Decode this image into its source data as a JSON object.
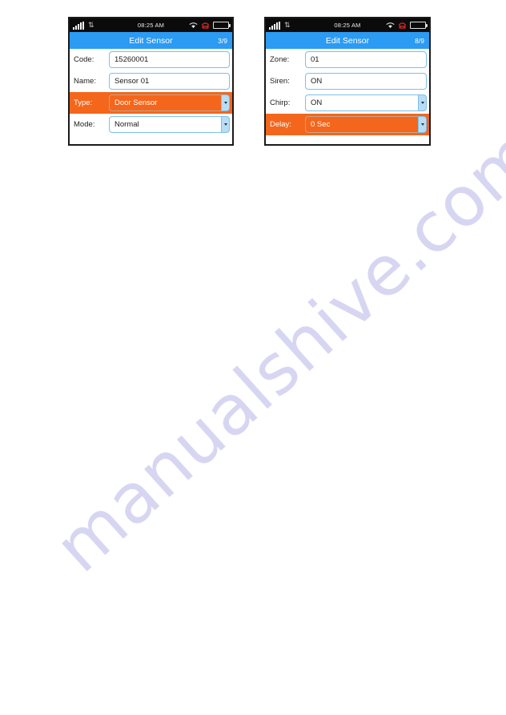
{
  "watermark": {
    "text": "manualshive.com",
    "color": "#d7d6f2"
  },
  "theme": {
    "title_bar_blue": "#2b9bf4",
    "highlight_orange": "#f4661b",
    "field_border_blue": "#7ec0e8",
    "dropdown_blue": "#b9ddf5",
    "battery_green": "#b5e61d",
    "phone_icon_red": "#d01f1f"
  },
  "screens": [
    {
      "status_bar": {
        "time": "08:25 AM",
        "signal_icon": "signal-bars-icon",
        "data_icon": "data-transfer-arrows-icon",
        "wifi_icon": "wifi-icon",
        "call_icon": "telephone-icon",
        "battery_icon": "battery-icon"
      },
      "title": "Edit Sensor",
      "page_indicator": "3/9",
      "rows": [
        {
          "label": "Code:",
          "value": "15260001",
          "dropdown": false,
          "highlight": false,
          "name": "code"
        },
        {
          "label": "Name:",
          "value": "Sensor 01",
          "dropdown": false,
          "highlight": false,
          "name": "name"
        },
        {
          "label": "Type:",
          "value": "Door Sensor",
          "dropdown": true,
          "highlight": true,
          "name": "type"
        },
        {
          "label": "Mode:",
          "value": "Normal",
          "dropdown": true,
          "highlight": false,
          "name": "mode"
        }
      ]
    },
    {
      "status_bar": {
        "time": "08:25 AM",
        "signal_icon": "signal-bars-icon",
        "data_icon": "data-transfer-arrows-icon",
        "wifi_icon": "wifi-icon",
        "call_icon": "telephone-icon",
        "battery_icon": "battery-icon"
      },
      "title": "Edit Sensor",
      "page_indicator": "8/9",
      "rows": [
        {
          "label": "Zone:",
          "value": "01",
          "dropdown": false,
          "highlight": false,
          "name": "zone"
        },
        {
          "label": "Siren:",
          "value": "ON",
          "dropdown": false,
          "highlight": false,
          "name": "siren"
        },
        {
          "label": "Chirp:",
          "value": "ON",
          "dropdown": true,
          "highlight": false,
          "name": "chirp"
        },
        {
          "label": "Delay:",
          "value": "0 Sec",
          "dropdown": true,
          "highlight": true,
          "name": "delay"
        }
      ]
    }
  ]
}
